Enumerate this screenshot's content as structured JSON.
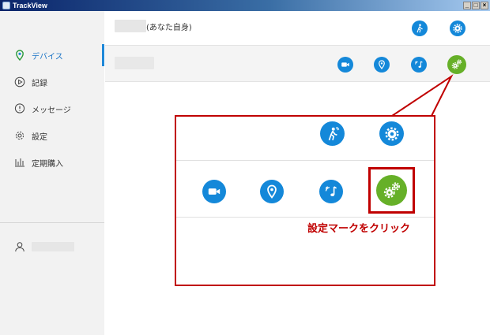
{
  "window": {
    "title": "TrackView",
    "minimize_glyph": "_",
    "maximize_glyph": "□",
    "close_glyph": "×"
  },
  "sidebar": {
    "items": [
      {
        "label": "デバイス",
        "icon": "location-pin-icon",
        "active": true
      },
      {
        "label": "記録",
        "icon": "play-circle-icon",
        "active": false
      },
      {
        "label": "メッセージ",
        "icon": "chat-bubble-icon",
        "active": false
      },
      {
        "label": "設定",
        "icon": "gear-icon",
        "active": false
      },
      {
        "label": "定期購入",
        "icon": "bar-chart-icon",
        "active": false
      }
    ],
    "user": {
      "icon": "user-icon"
    }
  },
  "devices": [
    {
      "name_suffix": "(あなた自身)",
      "actions": [
        "walking-person-icon",
        "settings-gear-icon"
      ]
    },
    {
      "name_suffix": "",
      "actions": [
        "video-camera-icon",
        "location-pin-icon",
        "music-note-icon",
        "gears-icon"
      ]
    }
  ],
  "callout": {
    "label": "設定マークをクリック",
    "border_color": "#c00000"
  },
  "colors": {
    "accent_blue": "#1488d9",
    "settings_green": "#66b028",
    "sidebar_bg": "#f2f2f2"
  }
}
